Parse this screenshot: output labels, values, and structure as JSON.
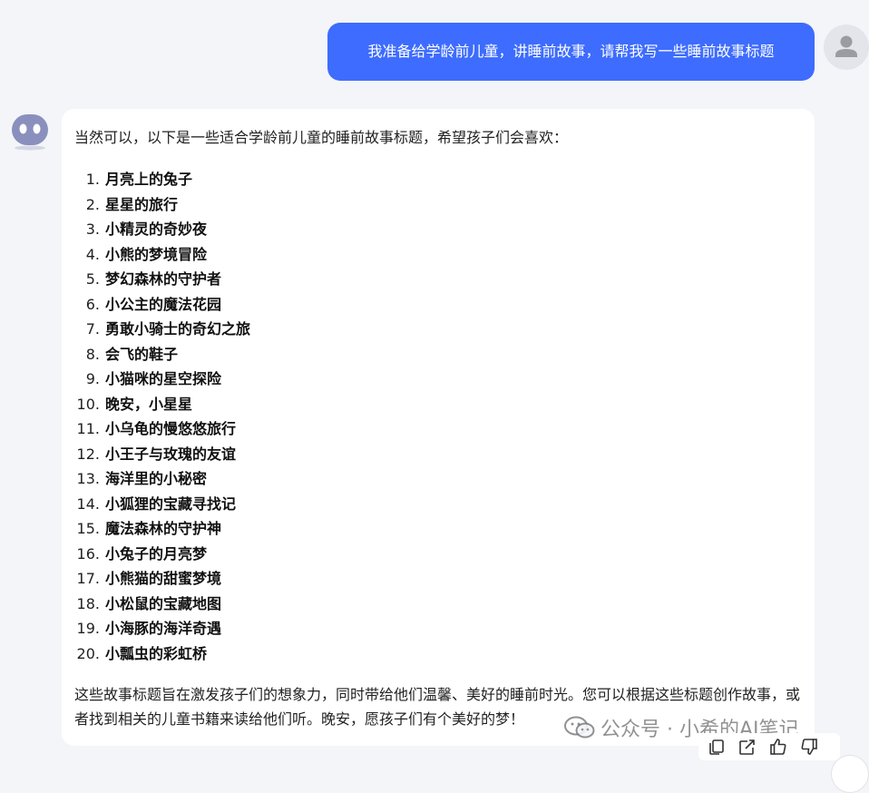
{
  "user_message": {
    "text": "我准备给学龄前儿童，讲睡前故事，请帮我写一些睡前故事标题"
  },
  "assistant_message": {
    "intro": "当然可以，以下是一些适合学龄前儿童的睡前故事标题，希望孩子们会喜欢：",
    "stories": [
      {
        "num": "1.",
        "title": "月亮上的兔子"
      },
      {
        "num": "2.",
        "title": "星星的旅行"
      },
      {
        "num": "3.",
        "title": "小精灵的奇妙夜"
      },
      {
        "num": "4.",
        "title": "小熊的梦境冒险"
      },
      {
        "num": "5.",
        "title": "梦幻森林的守护者"
      },
      {
        "num": "6.",
        "title": "小公主的魔法花园"
      },
      {
        "num": "7.",
        "title": "勇敢小骑士的奇幻之旅"
      },
      {
        "num": "8.",
        "title": "会飞的鞋子"
      },
      {
        "num": "9.",
        "title": "小猫咪的星空探险"
      },
      {
        "num": "10.",
        "title": "晚安，小星星"
      },
      {
        "num": "11.",
        "title": "小乌龟的慢悠悠旅行"
      },
      {
        "num": "12.",
        "title": "小王子与玫瑰的友谊"
      },
      {
        "num": "13.",
        "title": "海洋里的小秘密"
      },
      {
        "num": "14.",
        "title": "小狐狸的宝藏寻找记"
      },
      {
        "num": "15.",
        "title": "魔法森林的守护神"
      },
      {
        "num": "16.",
        "title": "小兔子的月亮梦"
      },
      {
        "num": "17.",
        "title": "小熊猫的甜蜜梦境"
      },
      {
        "num": "18.",
        "title": "小松鼠的宝藏地图"
      },
      {
        "num": "19.",
        "title": "小海豚的海洋奇遇"
      },
      {
        "num": "20.",
        "title": "小瓢虫的彩虹桥"
      }
    ],
    "outro": "这些故事标题旨在激发孩子们的想象力，同时带给他们温馨、美好的睡前时光。您可以根据这些标题创作故事，或者找到相关的儿童书籍来读给他们听。晚安，愿孩子们有个美好的梦！"
  },
  "watermark": {
    "text": "公众号 · 小希的AI笔记"
  },
  "toolbar": {
    "icons": [
      "copy-icon",
      "share-icon",
      "thumbs-up-icon",
      "thumbs-down-icon"
    ]
  },
  "colors": {
    "background": "#f4f5f9",
    "user_bubble": "#3d6cfe",
    "bot_avatar": "#8a90bd",
    "card": "#ffffff"
  }
}
